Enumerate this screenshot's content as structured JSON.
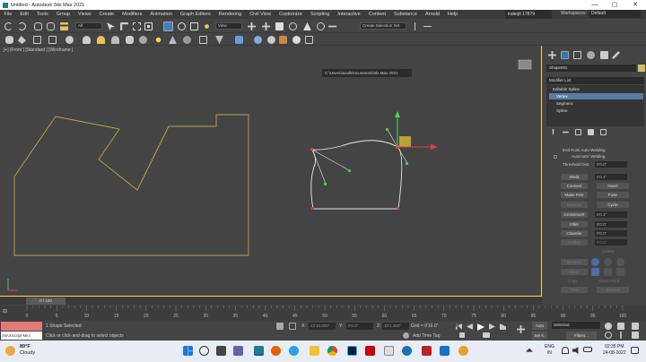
{
  "window": {
    "title": "Untitled - Autodesk 3ds Max 2021",
    "min": "—",
    "max": "▢",
    "close": "✕"
  },
  "menu": [
    "File",
    "Edit",
    "Tools",
    "Group",
    "Views",
    "Create",
    "Modifiers",
    "Animation",
    "Graph Editors",
    "Rendering",
    "Civil View",
    "Customize",
    "Scripting",
    "Interactive",
    "Content",
    "Substance",
    "Arnold",
    "Help"
  ],
  "user": {
    "name": "inderjit 17879"
  },
  "workspace": {
    "label": "Workspaces:",
    "value": "Default"
  },
  "toolbar": {
    "filter": "All",
    "refcoord": "View",
    "selset": "Create Selection Set"
  },
  "projectpath": "C:\\Users\\isoul\\Documents\\3ds Max 2021",
  "viewport": {
    "label": "[+] [Front ] [Standard ] [Wireframe ]"
  },
  "cmd": {
    "objname": "Shape002",
    "modlist": "Modifier List",
    "stack": [
      "Editable Spline",
      "Vertex",
      "Segment",
      "Spline"
    ],
    "selected": "Vertex"
  },
  "rollout": {
    "endpoint": "End Point Auto-Welding",
    "autoweld": "Automatic Welding",
    "thresh_label": "Threshold Dist.",
    "thresh_val": "0'0.0\"",
    "weld": "Weld",
    "weld_val": "0'0.1\"",
    "connect": "Connect",
    "insert": "Insert",
    "makefirst": "Make First",
    "fuse": "Fuse",
    "reverse": "Reverse",
    "cycle": "Cycle",
    "crossinsert": "CrossInsert",
    "crossinsert_val": "0'0.1\"",
    "fillet": "Fillet",
    "fillet_val": "0'0.0\"",
    "chamfer": "Chamfer",
    "chamfer_val": "0'0.0\"",
    "outline": "Outline",
    "outline_val": "0'0.0\"",
    "center": "Center",
    "boolean": "Boolean",
    "mirror": "Mirror",
    "copy": "Copy",
    "aboutpivot": "About Pivot",
    "trim": "Trim",
    "extend": "Extend"
  },
  "time": {
    "slider": "0 / 100",
    "ticks": [
      "0",
      "5",
      "10",
      "15",
      "20",
      "25",
      "30",
      "35",
      "40",
      "45",
      "50",
      "55",
      "60",
      "65",
      "70",
      "75",
      "80",
      "85",
      "90",
      "95",
      "100"
    ]
  },
  "status": {
    "selected": "1 Shape Selected",
    "prompt": "Click or click-and-drag to select objects",
    "script": "MAXScript Mini",
    "x_label": "X:",
    "x": "23'10.000\"",
    "y_label": "Y:",
    "y": "0'0.0\"",
    "z_label": "Z:",
    "z": "10'1.463\"",
    "grid": "Grid = 0'10.0\"",
    "addtag": "Add Time Tag",
    "auto": "Auto",
    "setk": "Set K.",
    "selmode": "Selected",
    "filters": "Filters..."
  },
  "weather": {
    "temp": "89°F",
    "cond": "Cloudy"
  },
  "sys": {
    "lang1": "ENG",
    "lang2": "IN",
    "time": "02:35 PM",
    "date": "24-08-2022"
  },
  "colors": {
    "accent": "#fcd64a",
    "selected": "#5a7ba7",
    "spline": "#b8a84a"
  }
}
